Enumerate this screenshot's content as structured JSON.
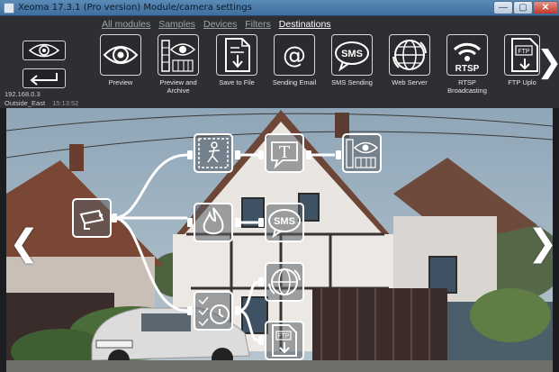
{
  "window": {
    "title": "Xeoma 17.3.1 (Pro version) Module/camera settings",
    "buttons": {
      "minimize": "—",
      "maximize": "▢",
      "close": "✕"
    }
  },
  "tabs": [
    {
      "label": "All modules",
      "active": false
    },
    {
      "label": "Samples",
      "active": false
    },
    {
      "label": "Devices",
      "active": false
    },
    {
      "label": "Filters",
      "active": false
    },
    {
      "label": "Destinations",
      "active": true
    }
  ],
  "toolbar": {
    "items": [
      {
        "label": "Preview",
        "icon": "eye-icon"
      },
      {
        "label": "Preview and Archive",
        "icon": "film-eye-icon"
      },
      {
        "label": "Save to File",
        "icon": "save-file-icon"
      },
      {
        "label": "Sending Email",
        "icon": "email-icon"
      },
      {
        "label": "SMS Sending",
        "icon": "sms-icon"
      },
      {
        "label": "Web Server",
        "icon": "globe-icon"
      },
      {
        "label": "RTSP Broadcasting",
        "icon": "rtsp-icon",
        "badge": "RTSP"
      },
      {
        "label": "FTP Uplo",
        "icon": "ftp-icon",
        "badge": "FTP"
      }
    ],
    "next_glyph": "❯"
  },
  "camera": {
    "ip": "192.168.0.3",
    "name": "Outside_East",
    "timestamp": "15:13:52"
  },
  "scene_nav": {
    "prev_glyph": "❮",
    "next_glyph": "❯"
  },
  "chain": {
    "nodes": [
      {
        "id": "camera",
        "icon": "camera-icon"
      },
      {
        "id": "motion",
        "icon": "motion-detector-icon"
      },
      {
        "id": "text",
        "icon": "text-overlay-icon",
        "glyph": "T"
      },
      {
        "id": "archive",
        "icon": "film-eye-icon"
      },
      {
        "id": "fire",
        "icon": "fire-detector-icon"
      },
      {
        "id": "sms",
        "icon": "sms-icon",
        "badge": "SMS"
      },
      {
        "id": "scheduler",
        "icon": "scheduler-icon"
      },
      {
        "id": "web",
        "icon": "globe-icon"
      },
      {
        "id": "ftp",
        "icon": "ftp-icon",
        "badge": "FTP"
      }
    ]
  },
  "colors": {
    "toolbar_bg": "#2d2f33",
    "title_bar": "#4a7cac",
    "sky": "#9fb3c3",
    "roof": "#7b4a39"
  }
}
